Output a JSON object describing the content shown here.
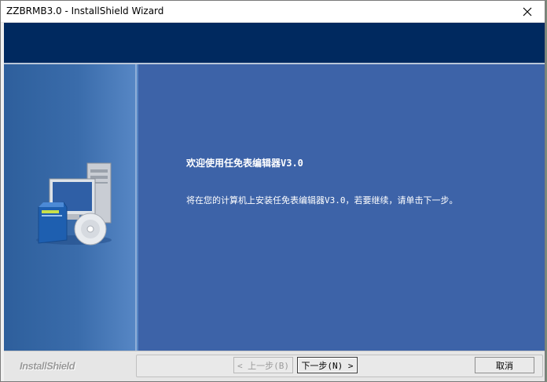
{
  "window": {
    "title": "ZZBRMB3.0 - InstallShield Wizard",
    "close_icon": "close-icon"
  },
  "welcome": {
    "title": "欢迎使用任免表编辑器V3.0",
    "body": "将在您的计算机上安装任免表编辑器V3.0，若要继续，请单击下一步。"
  },
  "footer": {
    "brand": "InstallShield",
    "back_label": "< 上一步(B)",
    "next_label": "下一步(N) >",
    "cancel_label": "取消"
  },
  "colors": {
    "banner": "#00295f",
    "panel": "#3d63a8"
  }
}
